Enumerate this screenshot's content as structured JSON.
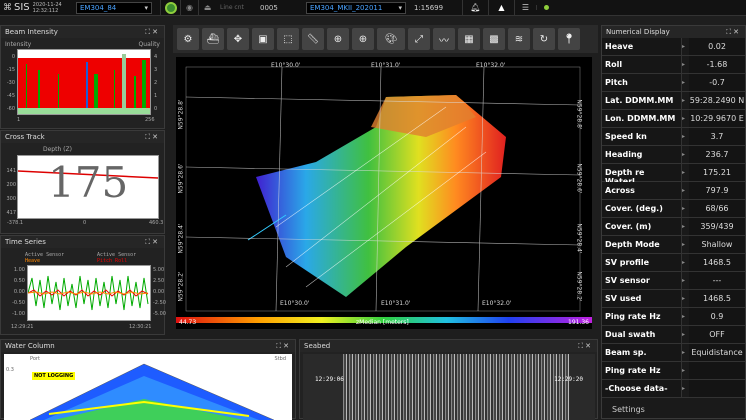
{
  "topbar": {
    "app": "SIS",
    "date": "2020-11-24",
    "time": "12:32:112",
    "sensor": "EM304_84",
    "line_cnt_label": "Line cnt",
    "line_cnt": "0005",
    "survey": "EM304_MKII_202011",
    "scale": "1:15699"
  },
  "beam_intensity": {
    "title": "Beam Intensity",
    "left_label": "Intensity",
    "right_label": "Quality",
    "y_left": [
      "0",
      "-15",
      "-30",
      "-45",
      "-60"
    ],
    "y_right": [
      "4",
      "3",
      "2",
      "1",
      "0"
    ],
    "x_start": "1",
    "x_end": "256"
  },
  "cross_track": {
    "title": "Cross Track",
    "axis": "Depth (Z)",
    "depth_value": "175",
    "y_ticks": [
      "141",
      "200",
      "300",
      "417"
    ],
    "x_start": "-378.1",
    "x_mid": "0",
    "x_end": "460.3"
  },
  "time_series": {
    "title": "Time Series",
    "left_title": "Active Sensor",
    "left_series": "Heave",
    "right_title": "Active Sensor",
    "right_series": "Pitch Roll",
    "y_left": [
      "1.00",
      "0.50",
      "0.00",
      "-0.50",
      "-1.00"
    ],
    "y_right": [
      "5.00",
      "2.50",
      "0.00",
      "-2.50",
      "-5.00"
    ],
    "t_start": "12:29:21",
    "t_end": "12:30:21"
  },
  "water_column": {
    "title": "Water Column",
    "port": "Port",
    "stbd": "Stbd",
    "scale": "0.3",
    "badge": "NOT LOGGING"
  },
  "seabed": {
    "title": "Seabed",
    "time1": "12:29:06",
    "time2": "12:29:20"
  },
  "map": {
    "lon_top": [
      "E10°30.0'",
      "E10°31.0'",
      "E10°32.0'"
    ],
    "lon_bottom": [
      "E10°30.0'",
      "E10°31.0'",
      "E10°32.0'"
    ],
    "lat_left": [
      "N59°28.6'",
      "N59°28.4'",
      "N59°28.2'"
    ],
    "lat_right": [
      "N59°28.6'",
      "N59°28.4'",
      "N59°28.2'"
    ],
    "lat_left_top": "N59°28.8'",
    "lat_right_top": "N59°28.8'",
    "colorbar_min": "44.73",
    "colorbar_label": "zMedian [meters]",
    "colorbar_max": "191.36"
  },
  "numerical": {
    "title": "Numerical Display",
    "rows": [
      {
        "k": "Heave",
        "v": "0.02"
      },
      {
        "k": "Roll",
        "v": "-1.68"
      },
      {
        "k": "Pitch",
        "v": "-0.7"
      },
      {
        "k": "Lat. DDMM.MM",
        "v": "59:28.2490 N"
      },
      {
        "k": "Lon. DDMM.MM",
        "v": "10:29.9670 E"
      },
      {
        "k": "Speed kn",
        "v": "3.7"
      },
      {
        "k": "Heading",
        "v": "236.7"
      },
      {
        "k": "Depth re Waterl.",
        "v": "175.21"
      },
      {
        "k": "Across",
        "v": "797.9"
      },
      {
        "k": "Cover. (deg.)",
        "v": "68/66"
      },
      {
        "k": "Cover. (m)",
        "v": "359/439"
      },
      {
        "k": "Depth Mode",
        "v": "Shallow"
      },
      {
        "k": "SV profile",
        "v": "1468.5"
      },
      {
        "k": "SV sensor",
        "v": "---"
      },
      {
        "k": "SV used",
        "v": "1468.5"
      },
      {
        "k": "Ping rate Hz",
        "v": "0.9"
      },
      {
        "k": "Dual swath",
        "v": "OFF"
      },
      {
        "k": "Beam sp.",
        "v": "Equidistance"
      },
      {
        "k": "Ping rate Hz",
        "v": ""
      },
      {
        "k": "-Choose data-",
        "v": ""
      }
    ],
    "settings": "Settings"
  },
  "colors": {
    "accent": "#2a90ff",
    "active": "#8fce3c"
  }
}
